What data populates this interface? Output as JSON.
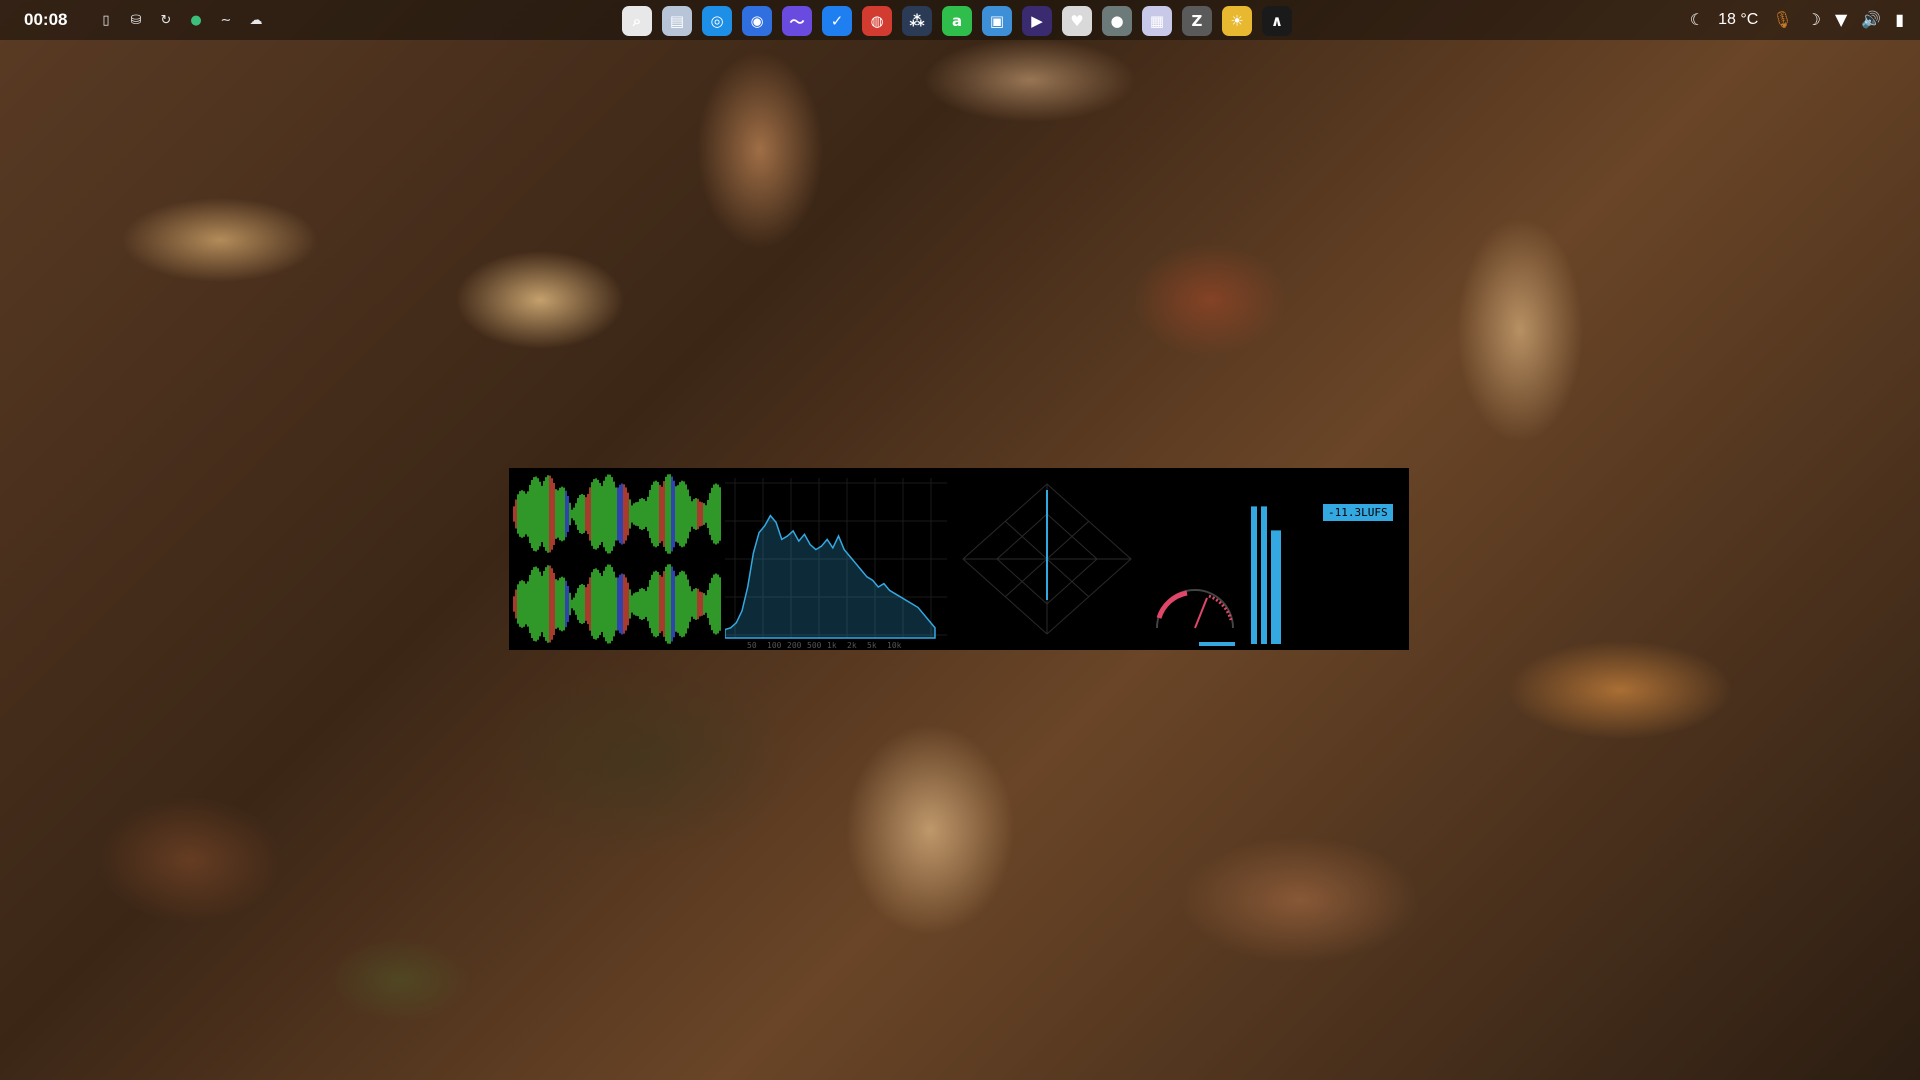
{
  "topbar": {
    "clock": "00:08",
    "left_tray_icons": [
      "phone-icon",
      "drive-icon",
      "refresh-icon",
      "globe-icon",
      "wave-icon",
      "cloud-icon"
    ],
    "dock_apps": [
      {
        "name": "search-app-icon",
        "color": "#e8e8e8",
        "glyph": "⌕"
      },
      {
        "name": "files-app-icon",
        "color": "#b8c4d8",
        "glyph": "▤"
      },
      {
        "name": "safari-app-icon",
        "color": "#1e8fe6",
        "glyph": "◎"
      },
      {
        "name": "browser-app-icon",
        "color": "#2f6fe0",
        "glyph": "◉"
      },
      {
        "name": "messenger-app-icon",
        "color": "#6a4be0",
        "glyph": "〜"
      },
      {
        "name": "tasks-app-icon",
        "color": "#1f7ff0",
        "glyph": "✓"
      },
      {
        "name": "chrome-app-icon",
        "color": "#d23b2f",
        "glyph": "◍"
      },
      {
        "name": "resolve-app-icon",
        "color": "#2b3a55",
        "glyph": "⁂"
      },
      {
        "name": "script-app-icon",
        "color": "#2fbd4b",
        "glyph": "a"
      },
      {
        "name": "camera-app-icon",
        "color": "#3d8fd8",
        "glyph": "▣"
      },
      {
        "name": "media-app-icon",
        "color": "#3a2a70",
        "glyph": "▶"
      },
      {
        "name": "cards-app-icon",
        "color": "#d9d9d9",
        "glyph": "♥"
      },
      {
        "name": "mic-app-icon",
        "color": "#6c7a7a",
        "glyph": "●"
      },
      {
        "name": "grid-app-icon",
        "color": "#c8c8e8",
        "glyph": "▦"
      },
      {
        "name": "notes-app-icon",
        "color": "#5a5a5a",
        "glyph": "Z"
      },
      {
        "name": "sun-app-icon",
        "color": "#e8b930",
        "glyph": "☀"
      },
      {
        "name": "audio-analyzer-app-icon",
        "color": "#1a1a1a",
        "glyph": "∧"
      }
    ],
    "weather": "18 °C",
    "right_tray_icons": [
      "weather-icon",
      "microphone-icon",
      "night-mode-icon",
      "wifi-icon",
      "volume-icon",
      "battery-icon"
    ]
  },
  "visualizer": {
    "lufs_label": "-11.3LUFS",
    "spectrum_ticks": [
      "50",
      "100",
      "200",
      "500",
      "1k",
      "2k",
      "5k",
      "10k"
    ],
    "spectrum": [
      5,
      6,
      9,
      16,
      30,
      50,
      62,
      66,
      72,
      68,
      58,
      60,
      63,
      57,
      61,
      55,
      52,
      54,
      58,
      53,
      60,
      52,
      48,
      44,
      40,
      36,
      34,
      30,
      32,
      28,
      26,
      24,
      22,
      20,
      18,
      14,
      10,
      6
    ],
    "meter_levels": [
      0.86,
      0.86,
      0.71
    ],
    "accent": "#34a9e1",
    "wave_green": "#3bbf33",
    "wave_red": "#d24a3a",
    "wave_blue": "#3b55d8"
  }
}
